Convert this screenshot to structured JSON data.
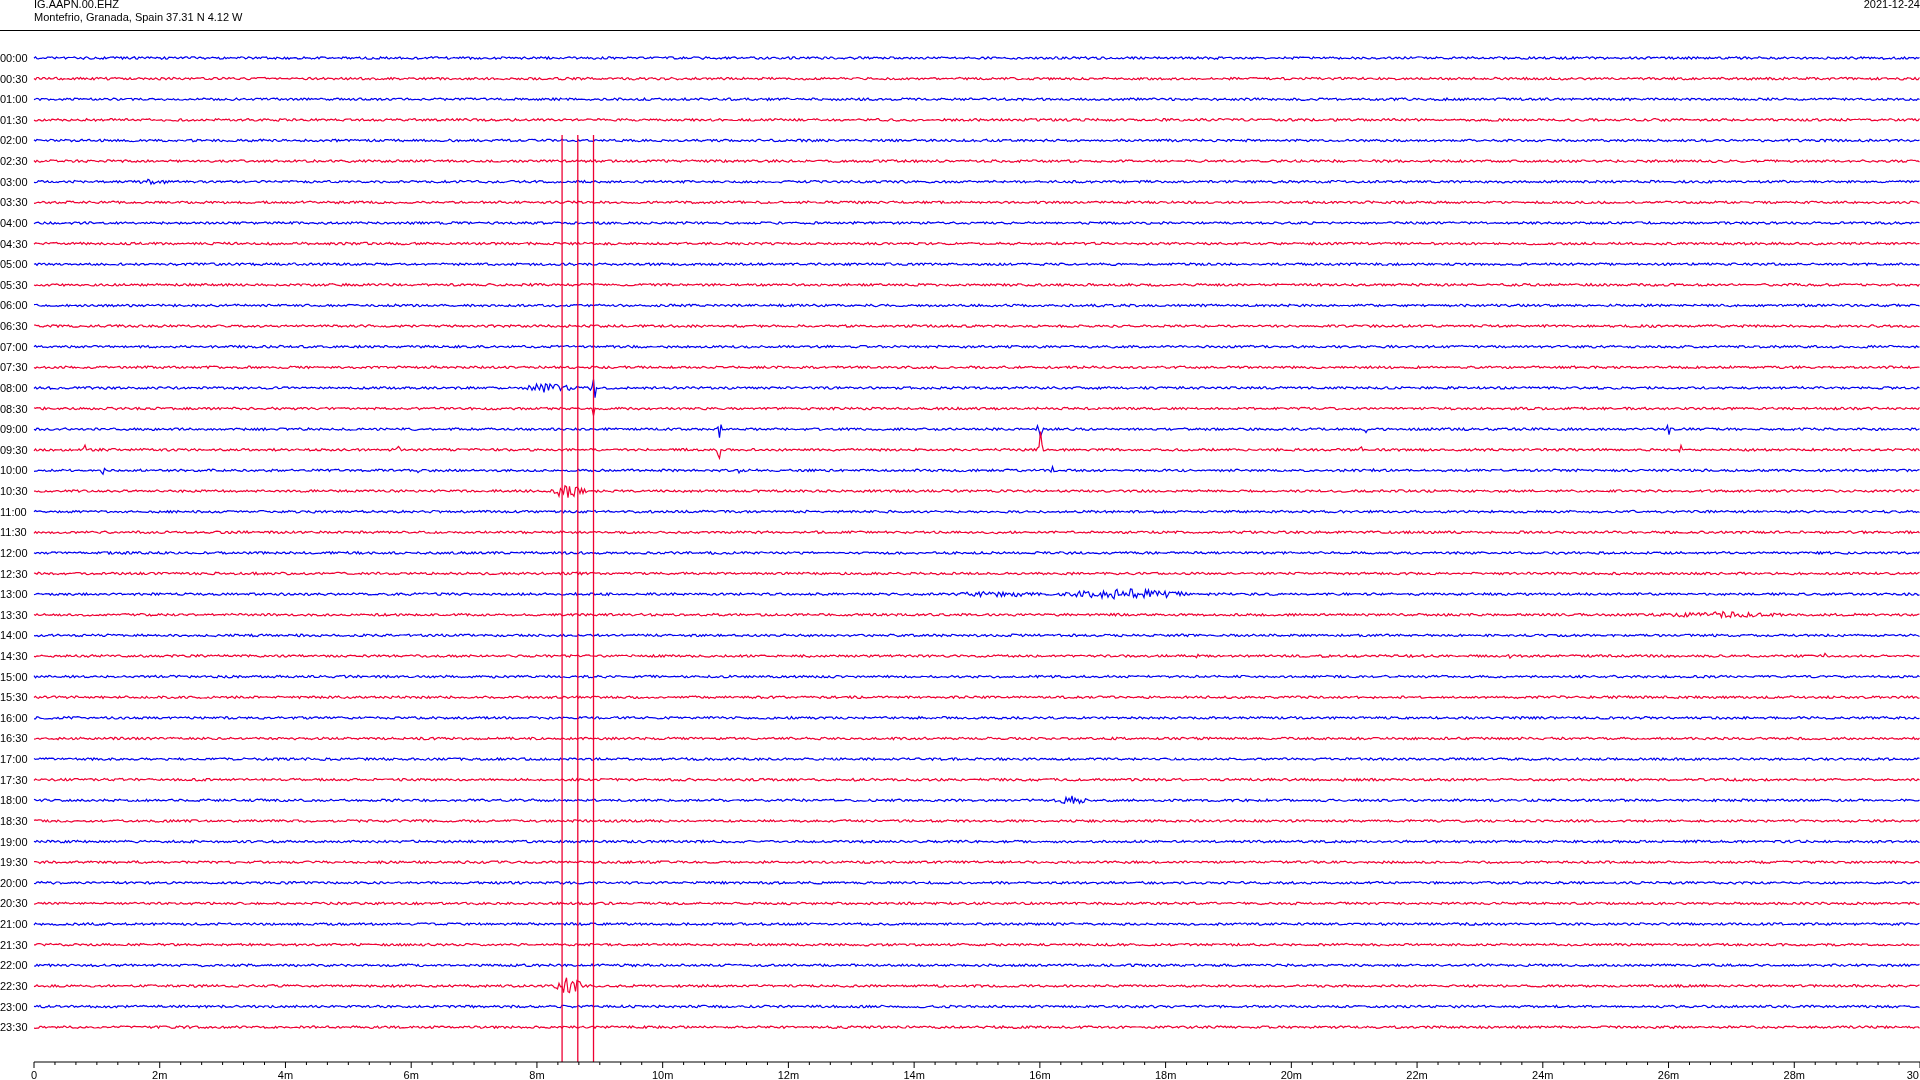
{
  "header": {
    "station": "IG.AAPN.00.EHZ",
    "location": "Montefrio, Granada, Spain  37.31 N 4.12 W",
    "date": "2021-12-24"
  },
  "rows": [
    {
      "time": "00:00",
      "color": "#0000ee"
    },
    {
      "time": "00:30",
      "color": "#ee0033"
    },
    {
      "time": "01:00",
      "color": "#0000ee"
    },
    {
      "time": "01:30",
      "color": "#ee0033"
    },
    {
      "time": "02:00",
      "color": "#0000ee"
    },
    {
      "time": "02:30",
      "color": "#ee0033"
    },
    {
      "time": "03:00",
      "color": "#0000ee"
    },
    {
      "time": "03:30",
      "color": "#ee0033"
    },
    {
      "time": "04:00",
      "color": "#0000ee"
    },
    {
      "time": "04:30",
      "color": "#ee0033"
    },
    {
      "time": "05:00",
      "color": "#0000ee"
    },
    {
      "time": "05:30",
      "color": "#ee0033"
    },
    {
      "time": "06:00",
      "color": "#0000ee"
    },
    {
      "time": "06:30",
      "color": "#ee0033"
    },
    {
      "time": "07:00",
      "color": "#0000ee"
    },
    {
      "time": "07:30",
      "color": "#ee0033"
    },
    {
      "time": "08:00",
      "color": "#0000ee"
    },
    {
      "time": "08:30",
      "color": "#ee0033"
    },
    {
      "time": "09:00",
      "color": "#0000ee"
    },
    {
      "time": "09:30",
      "color": "#ee0033"
    },
    {
      "time": "10:00",
      "color": "#0000ee"
    },
    {
      "time": "10:30",
      "color": "#ee0033"
    },
    {
      "time": "11:00",
      "color": "#0000ee"
    },
    {
      "time": "11:30",
      "color": "#ee0033"
    },
    {
      "time": "12:00",
      "color": "#0000ee"
    },
    {
      "time": "12:30",
      "color": "#ee0033"
    },
    {
      "time": "13:00",
      "color": "#0000ee"
    },
    {
      "time": "13:30",
      "color": "#ee0033"
    },
    {
      "time": "14:00",
      "color": "#0000ee"
    },
    {
      "time": "14:30",
      "color": "#ee0033"
    },
    {
      "time": "15:00",
      "color": "#0000ee"
    },
    {
      "time": "15:30",
      "color": "#ee0033"
    },
    {
      "time": "16:00",
      "color": "#0000ee"
    },
    {
      "time": "16:30",
      "color": "#ee0033"
    },
    {
      "time": "17:00",
      "color": "#0000ee"
    },
    {
      "time": "17:30",
      "color": "#ee0033"
    },
    {
      "time": "18:00",
      "color": "#0000ee"
    },
    {
      "time": "18:30",
      "color": "#ee0033"
    },
    {
      "time": "19:00",
      "color": "#0000ee"
    },
    {
      "time": "19:30",
      "color": "#ee0033"
    },
    {
      "time": "20:00",
      "color": "#0000ee"
    },
    {
      "time": "20:30",
      "color": "#ee0033"
    },
    {
      "time": "21:00",
      "color": "#0000ee"
    },
    {
      "time": "21:30",
      "color": "#ee0033"
    },
    {
      "time": "22:00",
      "color": "#0000ee"
    },
    {
      "time": "22:30",
      "color": "#ee0033"
    },
    {
      "time": "23:00",
      "color": "#0000ee"
    },
    {
      "time": "23:30",
      "color": "#ee0033"
    }
  ],
  "x_axis": {
    "tick_labels": [
      "0",
      "2m",
      "4m",
      "6m",
      "8m",
      "10m",
      "12m",
      "14m",
      "16m",
      "18m",
      "20m",
      "22m",
      "24m",
      "26m",
      "28m",
      "30"
    ]
  }
}
